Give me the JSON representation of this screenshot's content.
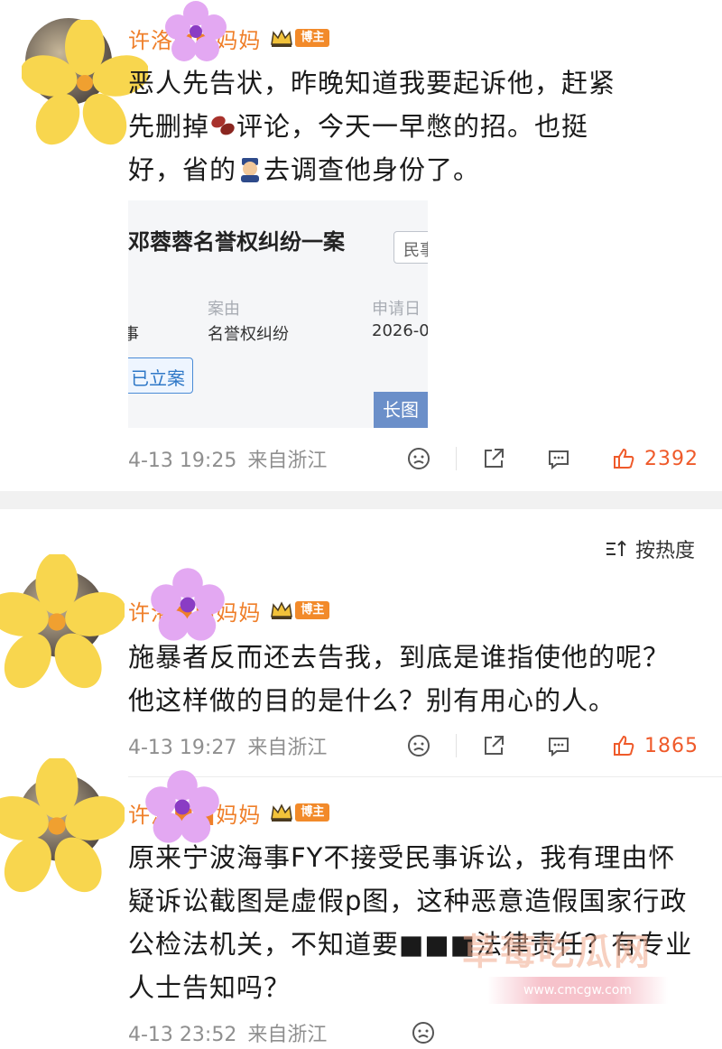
{
  "comments": [
    {
      "username": "许洛■■妈妈",
      "badge": "博主",
      "text_lines": [
        "恶人先告状，昨晚知道我要起诉他，赶紧",
        "先删掉",
        "评论，今天一早憋的招。也挺",
        "好，省的",
        "去调查他身份了。"
      ],
      "time": "4-13 19:25",
      "location": "来自浙江",
      "likes": "2392"
    },
    {
      "username": "许洛■■妈妈",
      "badge": "博主",
      "text": "施暴者反而还去告我，到底是谁指使他的呢？他这样做的目的是什么？别有用心的人。",
      "time": "4-13 19:27",
      "location": "来自浙江",
      "likes": "1865"
    },
    {
      "username": "许洛■■妈妈",
      "badge": "博主",
      "text": "原来宁波海事FY不接受民事诉讼，我有理由怀疑诉讼截图是虚假p图，这种恶意造假国家行政公检法机关，不知道要■■■法律责任？有专业人士告知吗？",
      "time": "4-13 23:52",
      "location": "来自浙江"
    }
  ],
  "embed": {
    "title": "邓蓉蓉名誉权纠纷一案",
    "tag": "民事",
    "label_cause": "案由",
    "label_date": "申请日",
    "value_left": "事",
    "value_cause": "名誉权纠纷",
    "value_date": "2026-0",
    "button": "已立案",
    "long_image": "长图"
  },
  "sort": {
    "label": "按热度",
    "icon": "sort-icon"
  },
  "watermark": {
    "text": "草莓吃瓜网",
    "url": "www.cmcgw.com"
  },
  "colors": {
    "username": "#ef7f2a",
    "like": "#ef5a2a",
    "meta": "#8f8f8f"
  }
}
